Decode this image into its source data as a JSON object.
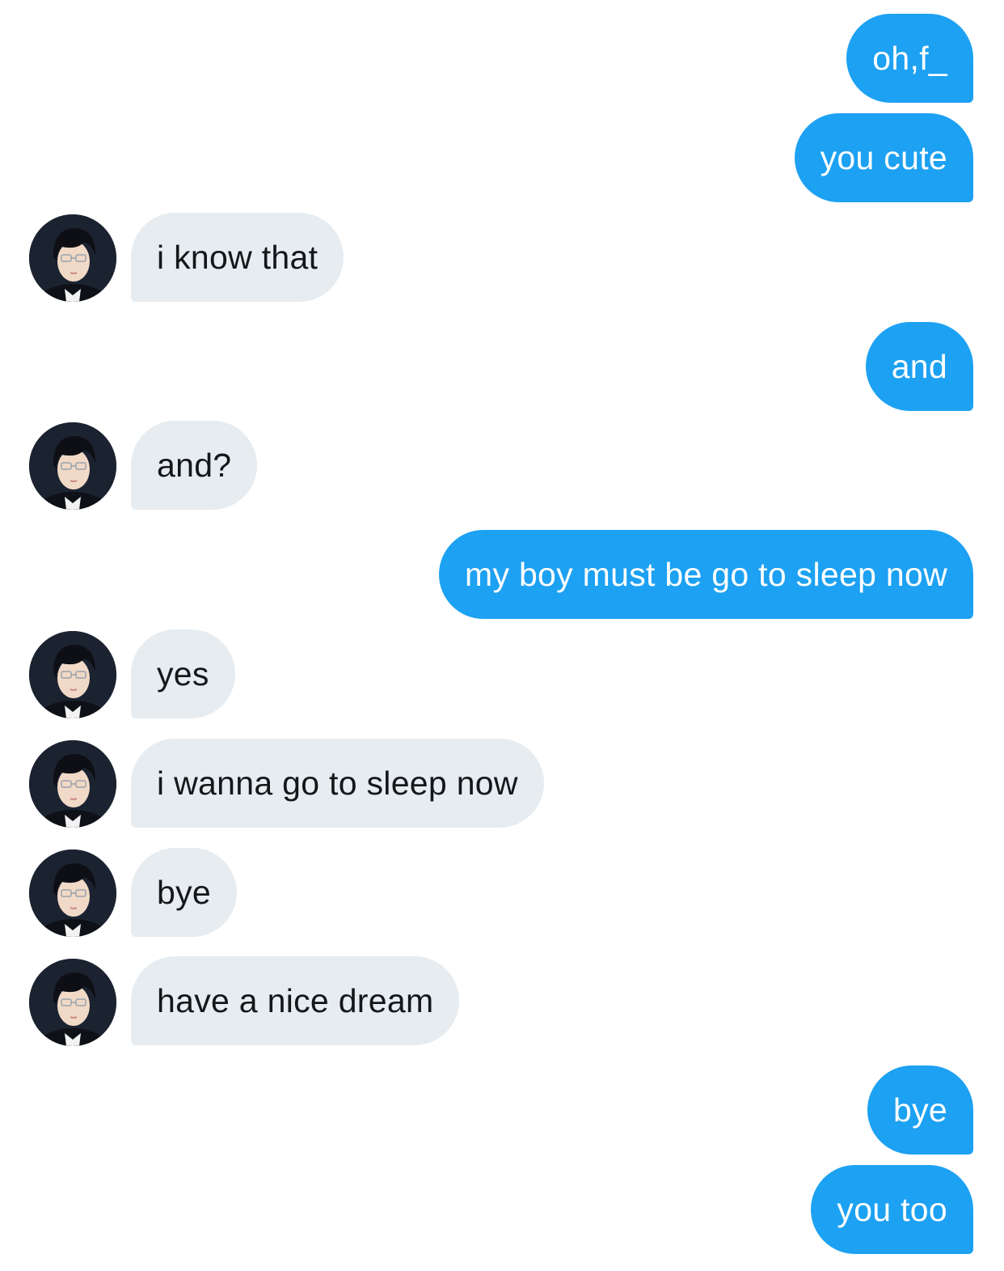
{
  "conversation": {
    "messages": [
      {
        "side": "sent",
        "text": "oh,f_"
      },
      {
        "side": "sent",
        "text": "you cute"
      },
      {
        "side": "received",
        "text": "i know that"
      },
      {
        "side": "sent",
        "text": "and"
      },
      {
        "side": "received",
        "text": "and?"
      },
      {
        "side": "sent",
        "text": "my boy must be go to sleep now"
      },
      {
        "side": "received",
        "text": "yes"
      },
      {
        "side": "received",
        "text": "i wanna go to sleep now"
      },
      {
        "side": "received",
        "text": "bye"
      },
      {
        "side": "received",
        "text": "have a nice dream"
      },
      {
        "side": "sent",
        "text": "bye"
      },
      {
        "side": "sent",
        "text": "you too"
      }
    ]
  },
  "colors": {
    "sent_bubble": "#1da1f2",
    "received_bubble": "#e6ecf0",
    "sent_text": "#ffffff",
    "received_text": "#14171a",
    "background": "#ffffff"
  },
  "icons": {
    "avatar": "avatar-photo"
  }
}
